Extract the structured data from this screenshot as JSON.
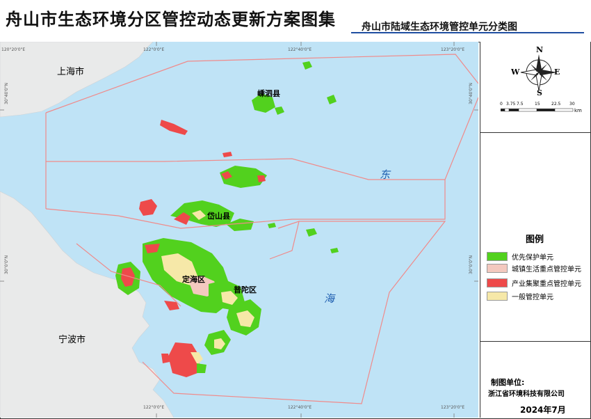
{
  "header": {
    "title": "舟山市生态环境分区管控动态更新方案图集",
    "subtitle": "舟山市陆域生态环境管控单元分类图"
  },
  "map": {
    "place_labels": {
      "shanghai": "上海市",
      "ningbo": "宁波市",
      "shengsi": "嵊泗县",
      "daishan": "岱山县",
      "dinghai": "定海区",
      "putuo": "普陀区"
    },
    "sea_labels": {
      "dong": "东",
      "hai": "海"
    },
    "graticule": {
      "top": [
        "120°20'0\"E",
        "122°0'0\"E",
        "122°40'0\"E",
        "123°20'0\"E"
      ],
      "bottom": [
        "122°0'0\"E",
        "122°40'0\"E",
        "123°20'0\"E"
      ],
      "left": [
        "30°40'0\"N",
        "30°0'0\"N"
      ],
      "right": [
        "30°40'0\"N",
        "30°0'0\"N"
      ]
    },
    "colors": {
      "sea": "#bfe3f6",
      "land": "#e9eaea",
      "priority": "#52d11e",
      "urban": "#f4c9bf",
      "industrial": "#ee4a4a",
      "general": "#f6e8a8",
      "boundary": "#f08a8a"
    }
  },
  "compass": {
    "n": "N",
    "s": "S",
    "e": "E",
    "w": "W",
    "scale_ticks": [
      "0",
      "3.75",
      "7.5",
      "15",
      "22.5",
      "30"
    ],
    "scale_unit": "km"
  },
  "legend": {
    "title": "图例",
    "items": [
      {
        "label": "优先保护单元",
        "color": "#52d11e"
      },
      {
        "label": "城镇生活重点管控单元",
        "color": "#f4c9bf"
      },
      {
        "label": "产业集聚重点管控单元",
        "color": "#ee4a4a"
      },
      {
        "label": "一般管控单元",
        "color": "#f6e8a8"
      }
    ]
  },
  "maker": {
    "label": "制图单位:",
    "name": "浙江省环境科技有限公司",
    "date": "2024年7月"
  }
}
